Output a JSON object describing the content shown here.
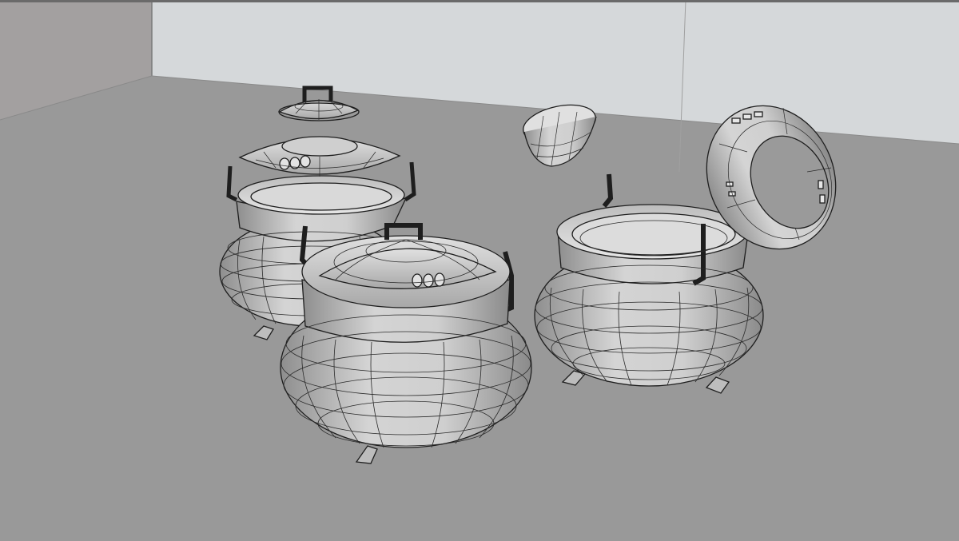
{
  "viewport": {
    "wireframe_color": "#1e1e1e",
    "mesh_light": "#d2d2d2",
    "mesh_shade": "#9a9a9a",
    "floor_color": "#999999",
    "back_wall_color": "#d6d9db",
    "left_wall_color": "#a29f9f"
  },
  "scene": {
    "objects": [
      "pot-back-left",
      "lid-top-back-left",
      "lid-ring-back-left",
      "pot-front-center",
      "pot-right-open",
      "lid-cup-floating",
      "lid-ring-floating-tilted"
    ]
  }
}
